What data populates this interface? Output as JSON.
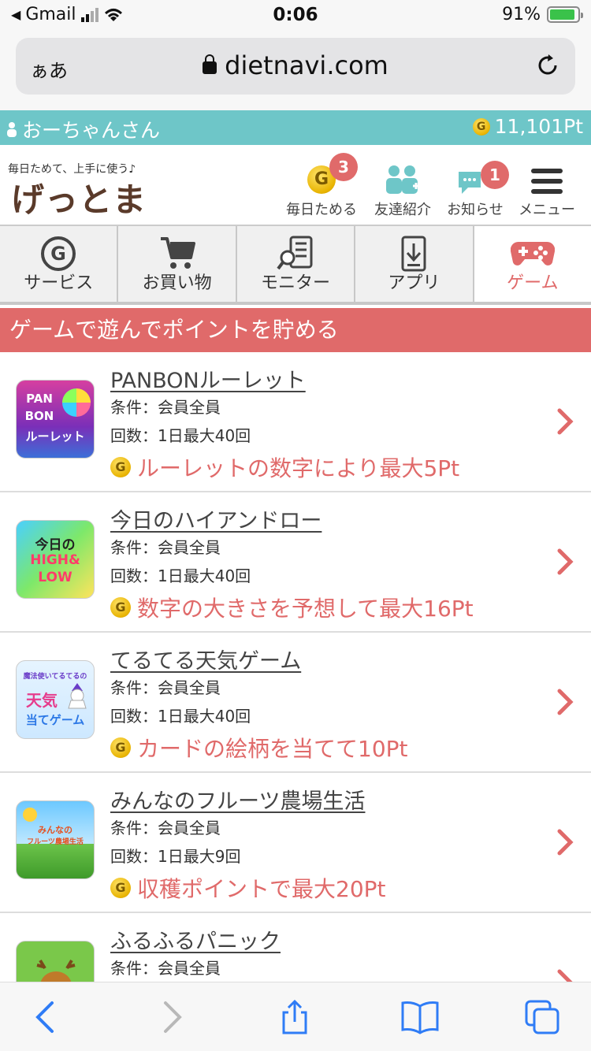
{
  "status": {
    "carrier": "Gmail",
    "time": "0:06",
    "battery": "91%"
  },
  "browser": {
    "aa": "ぁあ",
    "url": "dietnavi.com"
  },
  "userbar": {
    "name": "おーちゃんさん",
    "points": "11,101Pt"
  },
  "header": {
    "tagline": "毎日ためて、上手に使う♪",
    "logo": "げっとま",
    "nav": [
      {
        "label": "毎日ためる",
        "badge": "3"
      },
      {
        "label": "友達紹介"
      },
      {
        "label": "お知らせ",
        "badge": "1"
      },
      {
        "label": "メニュー"
      }
    ]
  },
  "tabs": [
    {
      "label": "サービス"
    },
    {
      "label": "お買い物"
    },
    {
      "label": "モニター"
    },
    {
      "label": "アプリ"
    },
    {
      "label": "ゲーム"
    }
  ],
  "section_title": "ゲームで遊んでポイントを貯める",
  "games": [
    {
      "title": "PANBONルーレット",
      "cond1": "条件：会員全員",
      "cond2": "回数：1日最大40回",
      "reward": "ルーレットの数字により最大5Pt",
      "thumb": [
        "PAN",
        "BON",
        "ルーレット"
      ]
    },
    {
      "title": "今日のハイアンドロー",
      "cond1": "条件：会員全員",
      "cond2": "回数：1日最大40回",
      "reward": "数字の大きさを予想して最大16Pt",
      "thumb": [
        "今日の",
        "HIGH&",
        "LOW"
      ]
    },
    {
      "title": "てるてる天気ゲーム",
      "cond1": "条件：会員全員",
      "cond2": "回数：1日最大40回",
      "reward": "カードの絵柄を当てて10Pt",
      "thumb": [
        "魔法使いてるてるの",
        "天気",
        "当てゲーム"
      ]
    },
    {
      "title": "みんなのフルーツ農場生活",
      "cond1": "条件：会員全員",
      "cond2": "回数：1日最大9回",
      "reward": "収穫ポイントで最大20Pt",
      "thumb": [
        "みんなの",
        "フルーツ農場生活",
        ""
      ]
    },
    {
      "title": "ふるふるパニック",
      "cond1": "条件：会員全員",
      "cond2": "",
      "reward": "",
      "thumb": [
        "",
        "",
        ""
      ]
    }
  ],
  "coin_glyph": "G"
}
